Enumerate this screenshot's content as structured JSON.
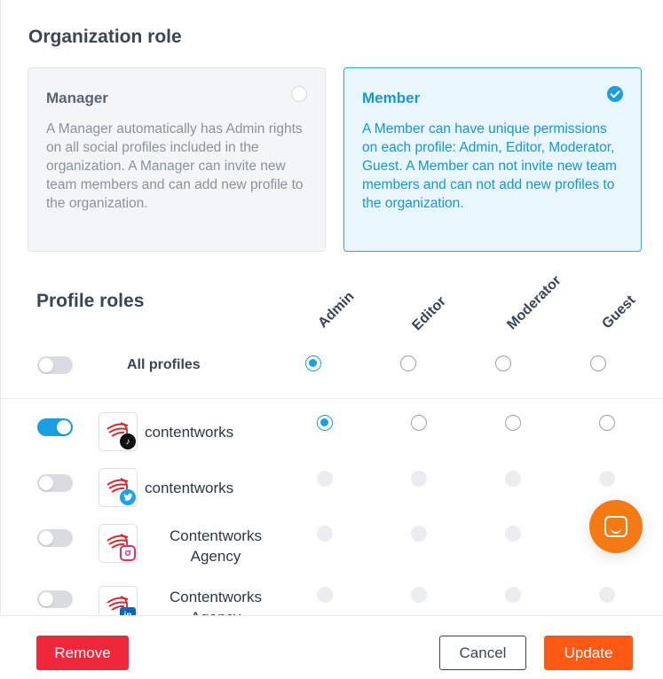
{
  "organization_role": {
    "title": "Organization role",
    "options": [
      {
        "title": "Manager",
        "description": "A Manager automatically has Admin rights on all social profiles included in the organization. A Manager can invite new team members and can add new profile to the organization.",
        "selected": false
      },
      {
        "title": "Member",
        "description": "A Member can have unique permissions on each profile: Admin, Editor, Moderator, Guest. A Member can not invite new team members and can not add new profiles to the organization.",
        "selected": true
      }
    ]
  },
  "profile_roles": {
    "title": "Profile roles",
    "columns": [
      "Admin",
      "Editor",
      "Moderator",
      "Guest"
    ],
    "all_profiles": {
      "label": "All profiles",
      "toggle_on": false,
      "selected_role": "Admin"
    },
    "profiles": [
      {
        "name": "contentworks",
        "network": "tiktok-icon",
        "toggle_on": true,
        "selected_role": "Admin"
      },
      {
        "name": "contentworks",
        "network": "twitter-icon",
        "toggle_on": false,
        "selected_role": null
      },
      {
        "name": "Contentworks Agency",
        "network": "instagram-icon",
        "toggle_on": false,
        "selected_role": null
      },
      {
        "name": "Contentworks Agency",
        "network": "linkedin-icon",
        "toggle_on": false,
        "selected_role": null
      }
    ]
  },
  "footer": {
    "remove_label": "Remove",
    "cancel_label": "Cancel",
    "update_label": "Update"
  },
  "colors": {
    "accent": "#1a9ee4",
    "remove": "#f0263a",
    "update": "#fe5a14",
    "chat": "#f47b14"
  }
}
